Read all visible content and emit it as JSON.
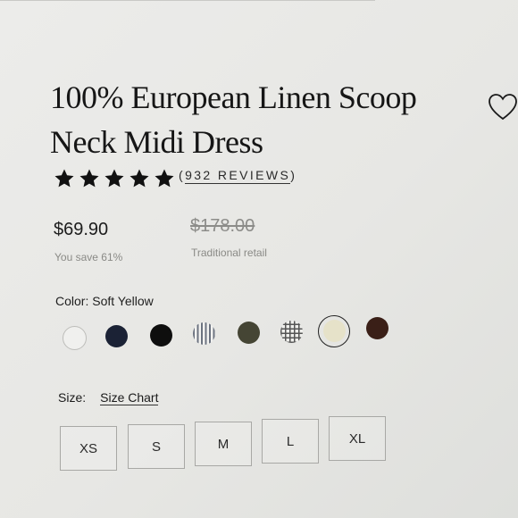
{
  "product": {
    "title": "100% European Linen Scoop Neck Midi Dress",
    "rating": {
      "stars": 5,
      "reviews_text": "(932 REVIEWS)",
      "open": "(",
      "count": "932 REVIEWS",
      "close": ")"
    },
    "price": "$69.90",
    "savings": "You save 61%",
    "retail_price": "$178.00",
    "retail_label": "Traditional retail"
  },
  "color": {
    "label": "Color: Soft Yellow",
    "selected_index": 7,
    "swatches": [
      {
        "name": "white",
        "hex": "#f0f0ee"
      },
      {
        "name": "navy",
        "hex": "#1b2235"
      },
      {
        "name": "black",
        "hex": "#0e0e0e"
      },
      {
        "name": "stripe",
        "hex": "#9aa1ab"
      },
      {
        "name": "olive",
        "hex": "#454534"
      },
      {
        "name": "gingham",
        "hex": "#6f6f6f"
      },
      {
        "name": "soft yellow",
        "hex": "#e6e2c9"
      },
      {
        "name": "brown",
        "hex": "#3a1f17"
      }
    ]
  },
  "size": {
    "label": "Size:",
    "chart_link": "Size Chart",
    "options": [
      "XS",
      "S",
      "M",
      "L",
      "XL"
    ]
  },
  "icons": {
    "wishlist": "heart-icon",
    "star": "star-icon"
  }
}
